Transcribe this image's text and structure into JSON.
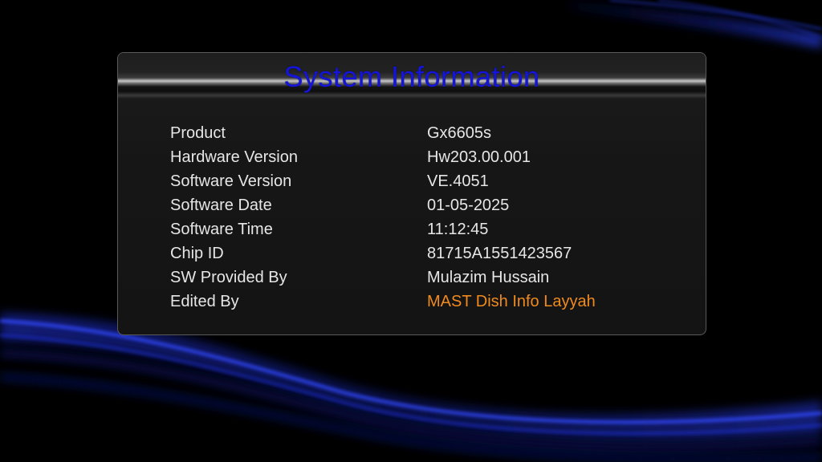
{
  "dialog": {
    "title": "System Information",
    "rows": [
      {
        "label": "Product",
        "value": "Gx6605s"
      },
      {
        "label": "Hardware Version",
        "value": "Hw203.00.001"
      },
      {
        "label": "Software Version",
        "value": "VE.4051"
      },
      {
        "label": "Software Date",
        "value": "01-05-2025"
      },
      {
        "label": "Software Time",
        "value": "11:12:45"
      },
      {
        "label": "Chip ID",
        "value": "81715A1551423567"
      },
      {
        "label": "SW Provided By",
        "value": "Mulazim Hussain"
      },
      {
        "label": "Edited By",
        "value": "MAST Dish Info Layyah"
      }
    ]
  },
  "colors": {
    "title": "#1515d8",
    "text": "#e6e6e6",
    "accent_value": "#f08a1e",
    "background": "#000000",
    "wave": "#1e2fd0"
  }
}
